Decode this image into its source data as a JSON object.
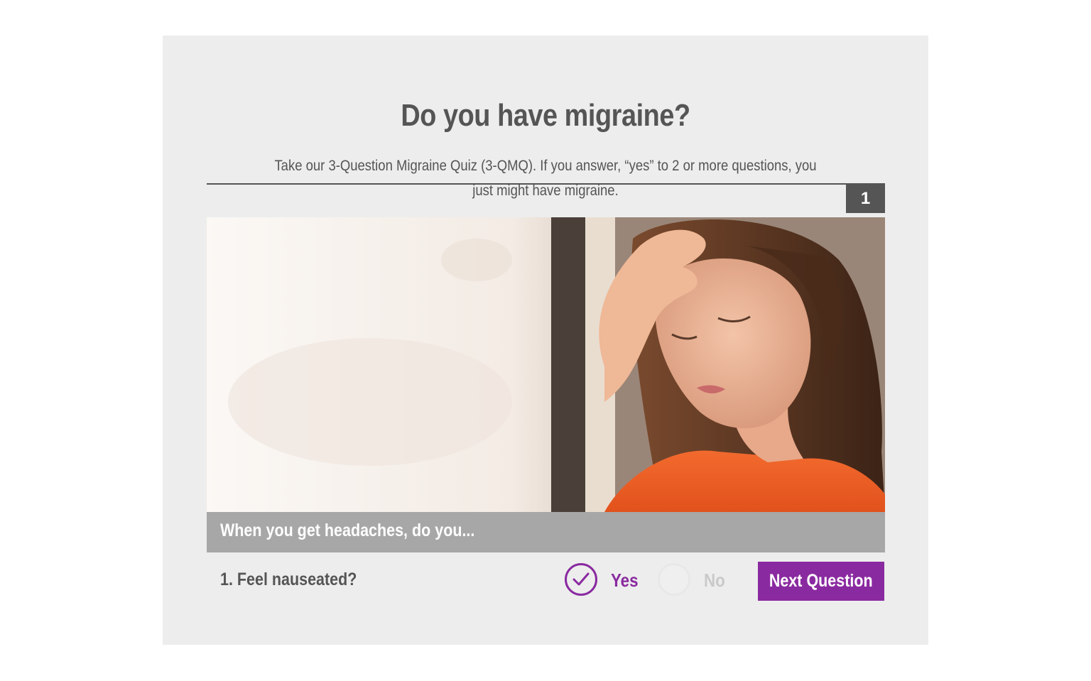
{
  "quiz": {
    "title": "Do you have migraine?",
    "intro": "Take our 3-Question Migraine Quiz (3-QMQ). If you answer, “yes” to 2 or more questions, you just might have migraine.",
    "step_number": "1",
    "prompt": "When you get headaches, do you...",
    "question": "1. Feel nauseated?",
    "answers": {
      "yes_label": "Yes",
      "no_label": "No",
      "selected": "Yes"
    },
    "next_button_label": "Next Question"
  },
  "colors": {
    "accent": "#8a2aa0",
    "card_background": "#ededed",
    "caption_bar": "#a7a7a7",
    "text": "#555555"
  }
}
